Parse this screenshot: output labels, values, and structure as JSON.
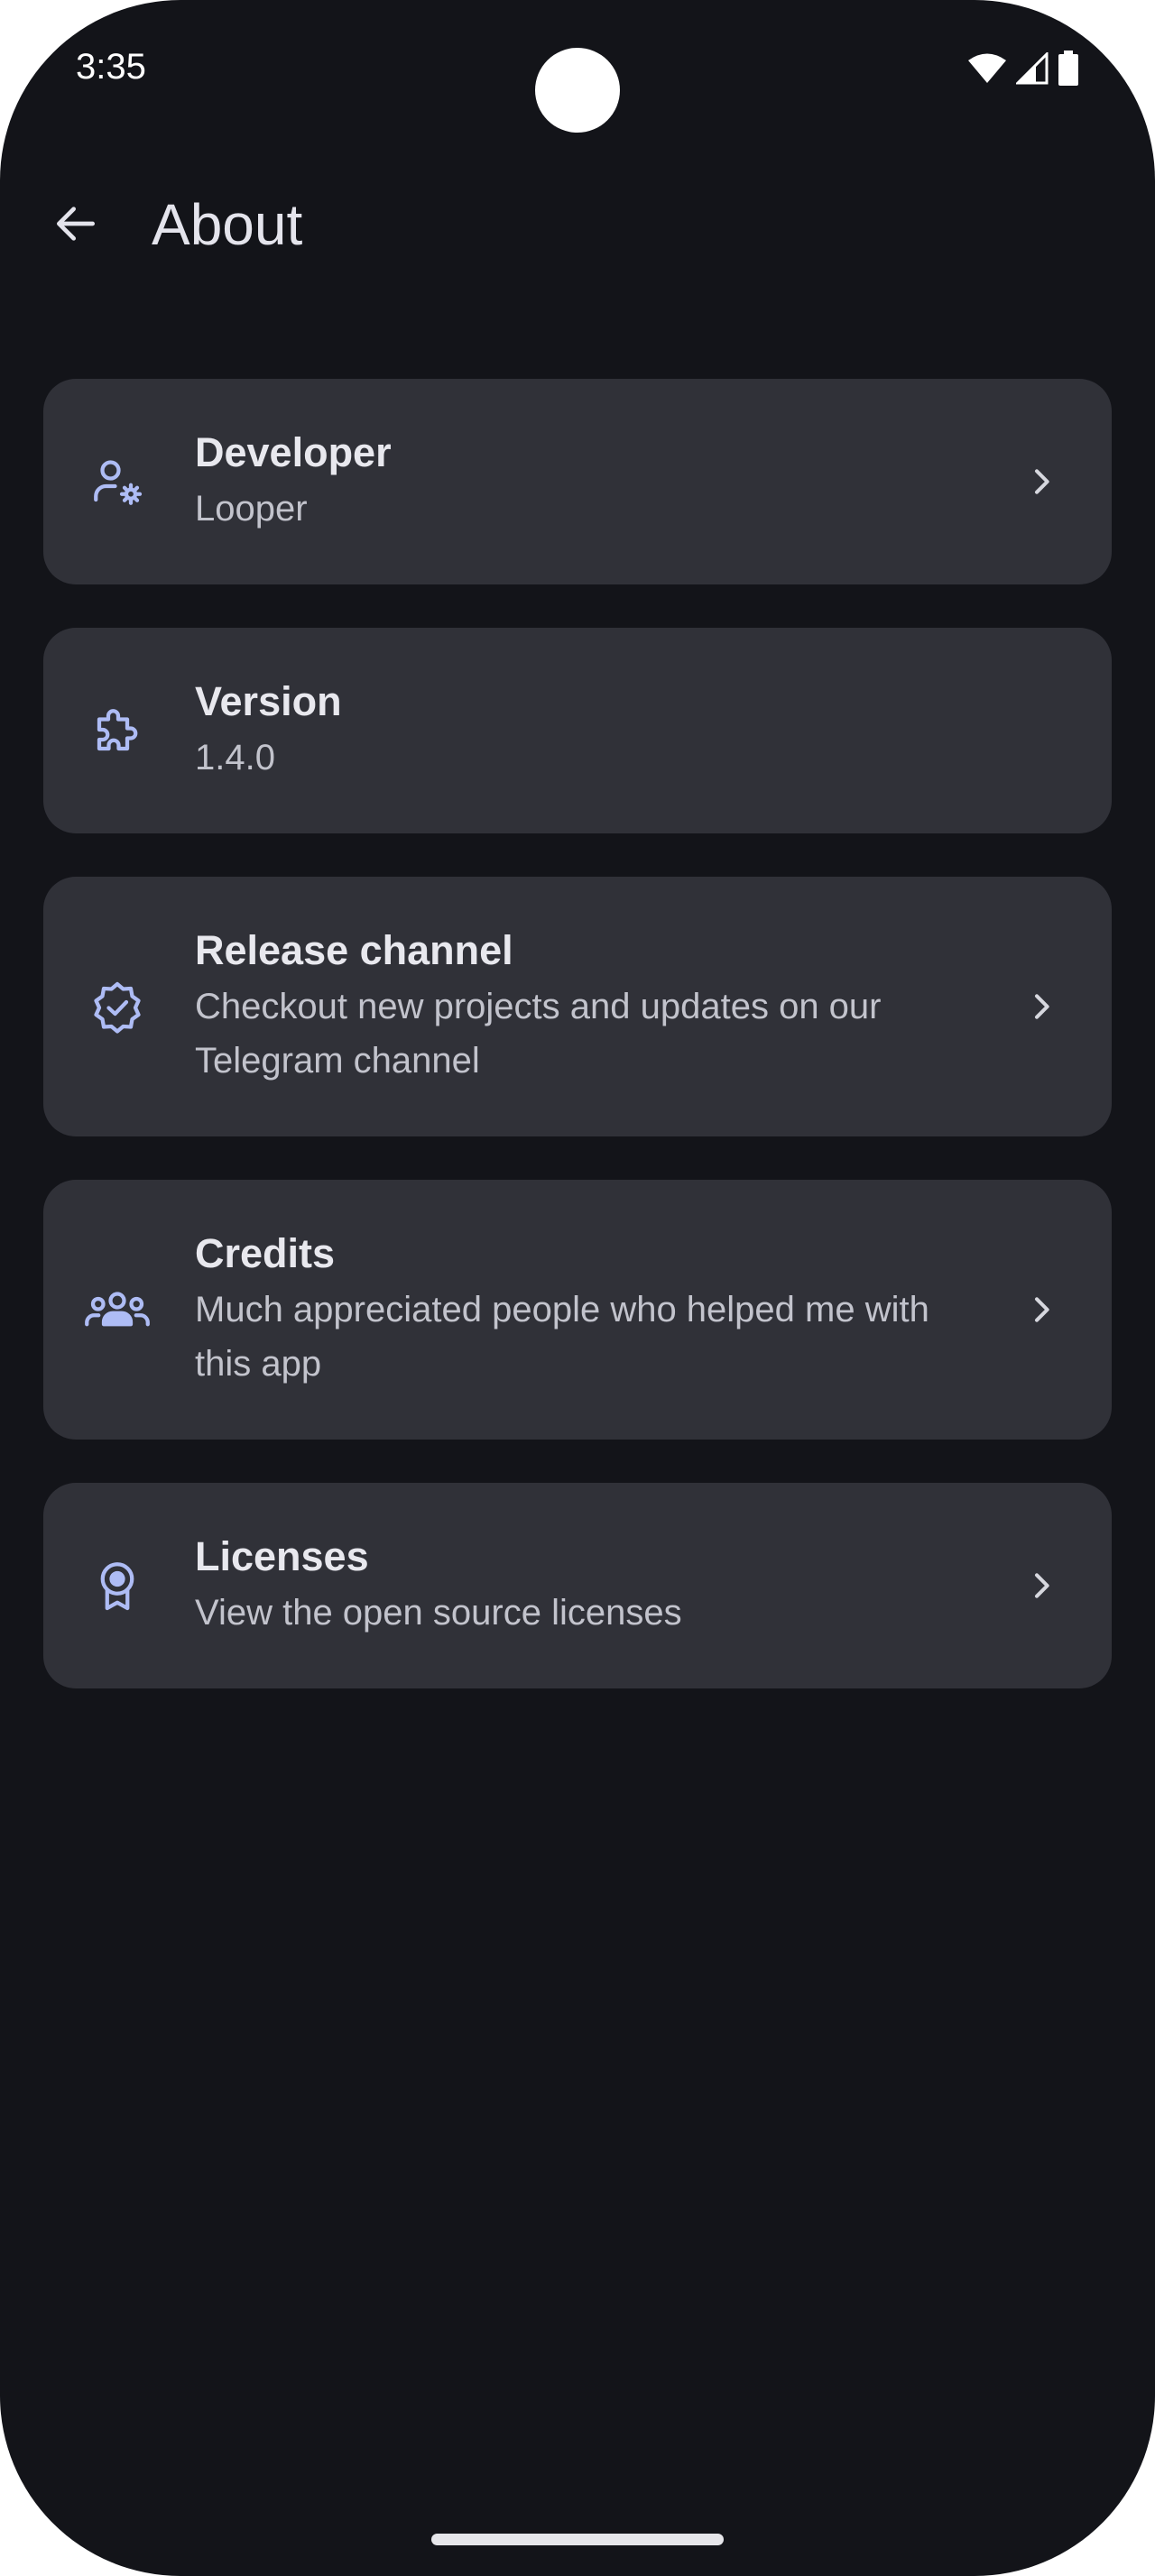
{
  "status_bar": {
    "time": "3:35",
    "icons": [
      "wifi-icon",
      "cellular-signal-icon",
      "battery-icon"
    ]
  },
  "header": {
    "back_icon": "arrow-back-icon",
    "title": "About"
  },
  "items": [
    {
      "icon": "person-settings-icon",
      "title": "Developer",
      "subtitle": "Looper",
      "has_chevron": true
    },
    {
      "icon": "extension-puzzle-icon",
      "title": "Version",
      "subtitle": "1.4.0",
      "has_chevron": false
    },
    {
      "icon": "verified-badge-icon",
      "title": "Release channel",
      "subtitle_lines": [
        "Checkout new projects and updates on our",
        "Telegram channel"
      ],
      "has_chevron": true
    },
    {
      "icon": "group-icon",
      "title": "Credits",
      "subtitle_lines": [
        "Much appreciated people who helped me with",
        "this app"
      ],
      "has_chevron": true
    },
    {
      "icon": "award-ribbon-icon",
      "title": "Licenses",
      "subtitle": "View the open source licenses",
      "has_chevron": true
    }
  ],
  "colors": {
    "background": "#131419",
    "card": "#303138",
    "icon_accent": "#aebcf5",
    "title_text": "#e8e8ee",
    "subtitle_text": "#c2c3cc"
  }
}
